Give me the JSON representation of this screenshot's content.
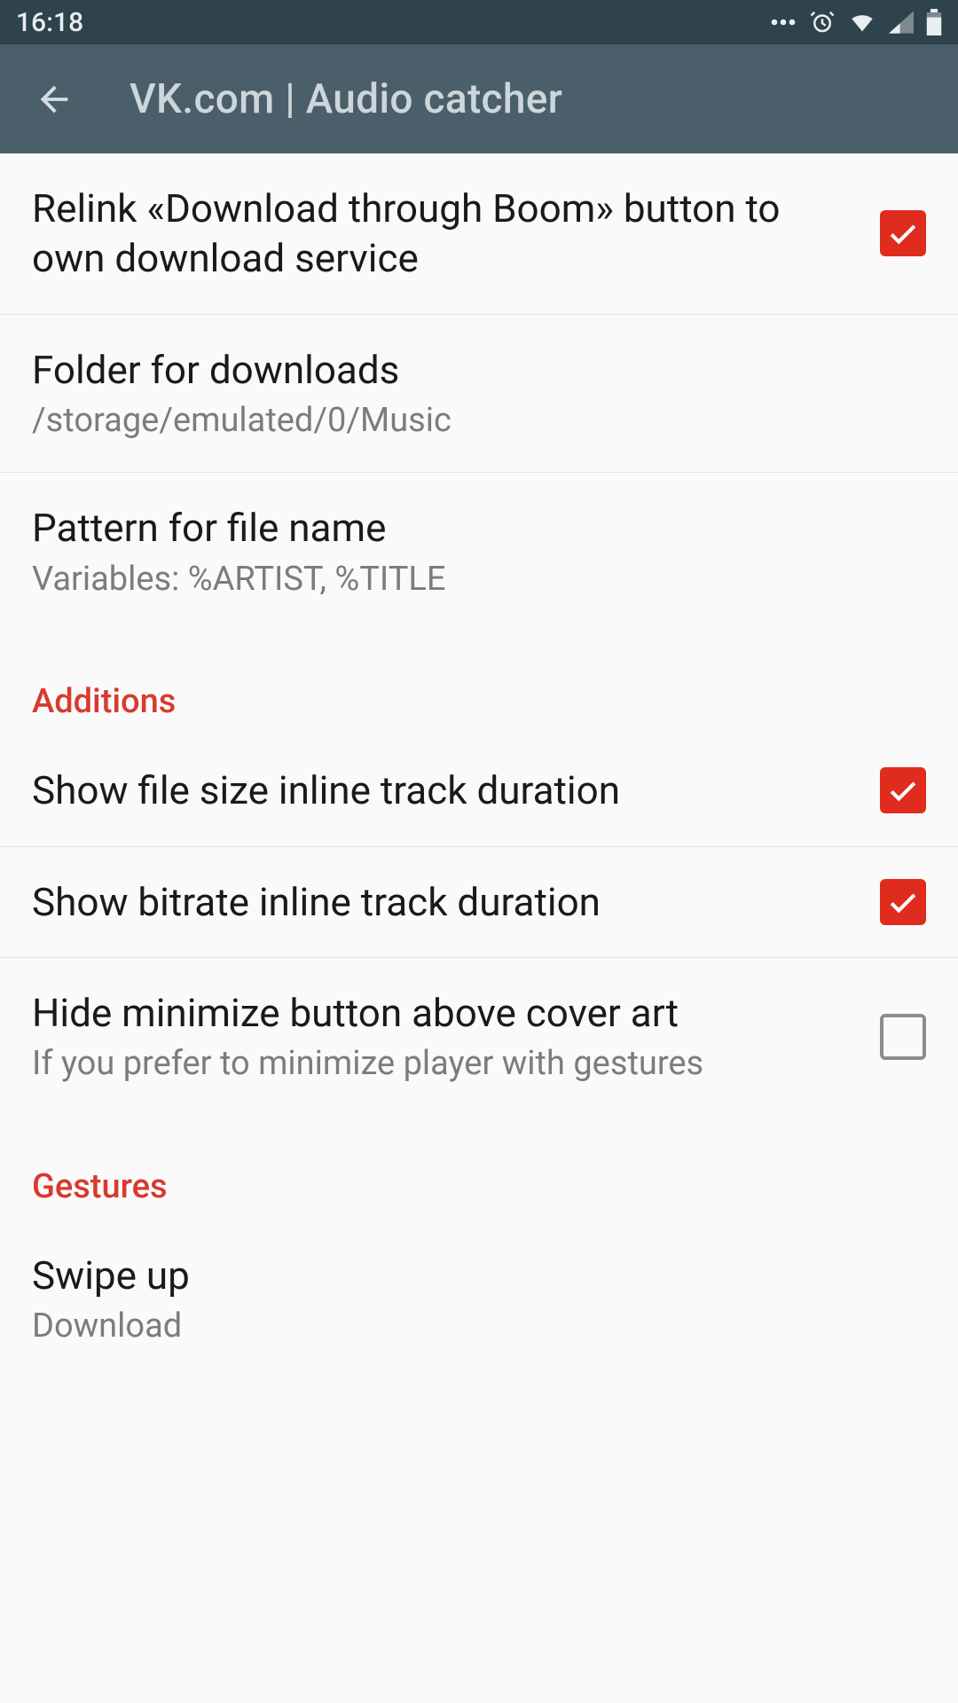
{
  "status": {
    "time": "16:18",
    "icons": {
      "more": "more-icon",
      "alarm": "alarm-icon",
      "wifi": "wifi-icon",
      "cell": "cell-icon",
      "battery": "battery-icon"
    }
  },
  "appbar": {
    "title": "VK.com | Audio catcher"
  },
  "settings": {
    "relink": {
      "label": "Relink «Download through Boom» button to own download service",
      "checked": true
    },
    "folder": {
      "label": "Folder for downloads",
      "value": "/storage/emulated/0/Music"
    },
    "pattern": {
      "label": "Pattern for file name",
      "value": "Variables: %ARTIST, %TITLE"
    },
    "section_additions": "Additions",
    "show_filesize": {
      "label": "Show file size inline track duration",
      "checked": true
    },
    "show_bitrate": {
      "label": "Show bitrate inline track duration",
      "checked": true
    },
    "hide_minimize": {
      "label": "Hide minimize button above cover art",
      "sub": "If you prefer to minimize player with gestures",
      "checked": false
    },
    "section_gestures": "Gestures",
    "swipe_up": {
      "label": "Swipe up",
      "value": "Download"
    }
  }
}
